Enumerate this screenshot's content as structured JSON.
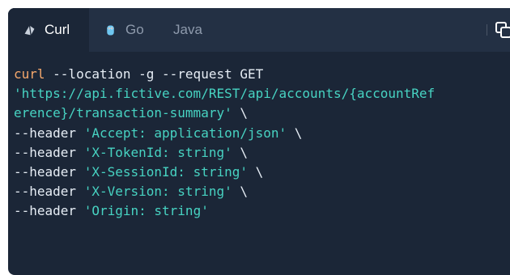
{
  "tabs": [
    {
      "label": "Curl",
      "icon": "curl-icon",
      "active": true
    },
    {
      "label": "Go",
      "icon": "go-gopher-icon",
      "active": false
    },
    {
      "label": "Java",
      "active": false
    }
  ],
  "copy_icon": "copy-icon",
  "code": {
    "line1_cmd": "curl",
    "line1_rest": " --location -g --request GET",
    "line2_str": "'https://api.fictive.com/REST/api/accounts/{accountRef",
    "line3_str": "erence}/transaction-summary'",
    "line3_rest": " \\",
    "header_flag": "--header ",
    "headers": [
      {
        "value": "'Accept: application/json'",
        "suffix": " \\"
      },
      {
        "value": "'X-TokenId: string'",
        "suffix": " \\"
      },
      {
        "value": "'X-SessionId: string'",
        "suffix": " \\"
      },
      {
        "value": "'X-Version: string'",
        "suffix": " \\"
      },
      {
        "value": "'Origin: string'",
        "suffix": ""
      }
    ]
  },
  "colors": {
    "panel_bg": "#1b2637",
    "tabbar_bg": "#233044",
    "keyword": "#f6a86c",
    "string": "#47d3c2",
    "text": "#e6edf5"
  }
}
